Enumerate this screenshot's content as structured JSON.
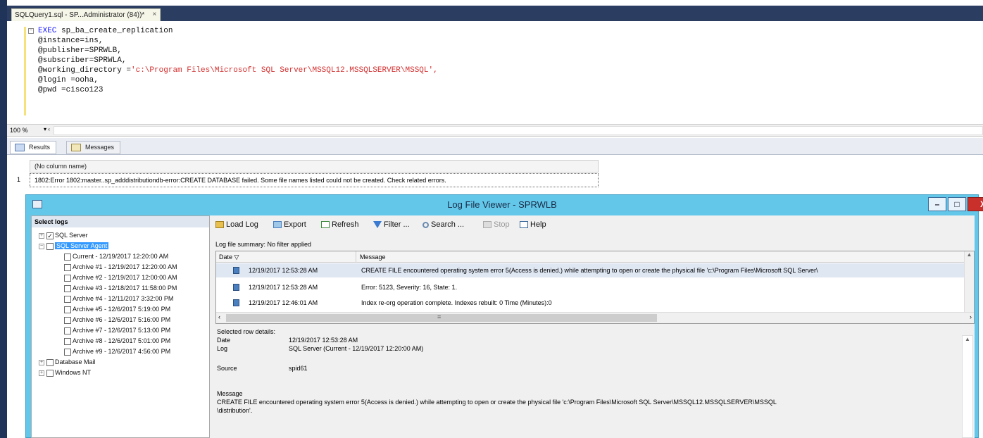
{
  "document_tab": {
    "label": "SQLQuery1.sql - SP...Administrator (84))*",
    "close": "×"
  },
  "editor": {
    "lines": [
      {
        "kw": "EXEC",
        "text": " sp_ba_create_replication"
      },
      {
        "text": "@instance=ins,"
      },
      {
        "text": "@publisher=SPRWLB,"
      },
      {
        "text": "@subscriber=SPRWLA,"
      },
      {
        "text": "@working_directory =",
        "str": "'c:\\Program Files\\Microsoft SQL Server\\MSSQL12.MSSQLSERVER\\MSSQL',"
      },
      {
        "text": "@login =ooha,"
      },
      {
        "text": "@pwd =cisco123"
      }
    ]
  },
  "zoom": {
    "value": "100 %",
    "arrow": "▾ ‹"
  },
  "results": {
    "tabs": [
      {
        "label": "Results"
      },
      {
        "label": "Messages"
      }
    ],
    "column_header": "(No column name)",
    "rows": [
      {
        "num": "1",
        "value": "1802:Error 1802:master..sp_adddistributiondb-error:CREATE DATABASE failed. Some file names listed could not be created. Check related errors."
      }
    ]
  },
  "log_viewer": {
    "title": "Log File Viewer - SPRWLB",
    "buttons": {
      "min": "–",
      "max": "□",
      "close": "X"
    },
    "select_logs": "Select logs",
    "tree": [
      {
        "label": "SQL Server",
        "checked": "✓",
        "expander": "+"
      },
      {
        "label": "SQL Server Agent",
        "expander": "−"
      },
      {
        "label": "Current - 12/19/2017 12:20:00 AM"
      },
      {
        "label": "Archive #1 - 12/19/2017 12:20:00 AM"
      },
      {
        "label": "Archive #2 - 12/19/2017 12:00:00 AM"
      },
      {
        "label": "Archive #3 - 12/18/2017 11:58:00 PM"
      },
      {
        "label": "Archive #4 - 12/11/2017 3:32:00 PM"
      },
      {
        "label": "Archive #5 - 12/6/2017 5:19:00 PM"
      },
      {
        "label": "Archive #6 - 12/6/2017 5:16:00 PM"
      },
      {
        "label": "Archive #7 - 12/6/2017 5:13:00 PM"
      },
      {
        "label": "Archive #8 - 12/6/2017 5:01:00 PM"
      },
      {
        "label": "Archive #9 - 12/6/2017 4:56:00 PM"
      },
      {
        "label": "Database Mail",
        "expander": "+"
      },
      {
        "label": "Windows NT",
        "expander": "+"
      }
    ],
    "toolbar": {
      "load_log": "Load Log",
      "export": "Export",
      "refresh": "Refresh",
      "filter": "Filter ...",
      "search": "Search ...",
      "stop": "Stop",
      "help": "Help"
    },
    "summary": "Log file summary: No filter applied",
    "columns": {
      "date": "Date",
      "message": "Message",
      "sort": "▽"
    },
    "entries": [
      {
        "date": "12/19/2017 12:53:28 AM",
        "message": "CREATE FILE encountered operating system error 5(Access is denied.) while attempting to open or create the physical file 'c:\\Program Files\\Microsoft SQL Server\\"
      },
      {
        "date": "12/19/2017 12:53:28 AM",
        "message": "Error: 5123, Severity: 16, State: 1."
      },
      {
        "date": "12/19/2017 12:46:01 AM",
        "message": "Index re-org operation complete. Indexes rebuilt: 0    Time (Minutes):0"
      }
    ],
    "scroll": {
      "up": "▲",
      "down": "▼",
      "left": "‹",
      "right": "›",
      "grip": "≡"
    },
    "details": {
      "header": "Selected row details:",
      "date_label": "Date",
      "date_value": "12/19/2017 12:53:28 AM",
      "log_label": "Log",
      "log_value": "SQL Server (Current - 12/19/2017 12:20:00 AM)",
      "source_label": "Source",
      "source_value": "spid61",
      "message_label": "Message",
      "message_value": "CREATE FILE encountered operating system error 5(Access is denied.) while attempting to open or create the physical file 'c:\\Program Files\\Microsoft SQL Server\\MSSQL12.MSSQLSERVER\\MSSQL",
      "message_value_2": "\\distribution'."
    }
  }
}
